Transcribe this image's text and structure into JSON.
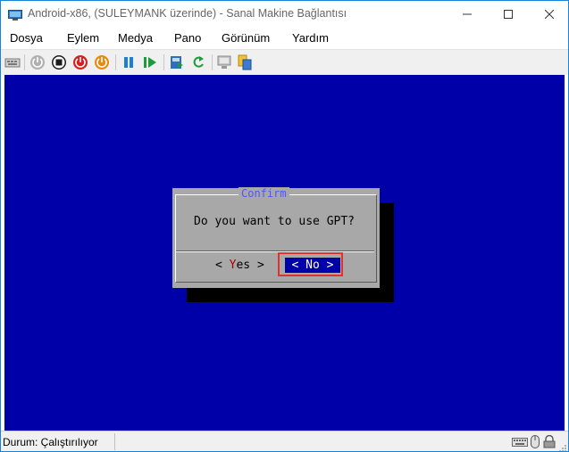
{
  "window": {
    "title": "Android-x86, (SULEYMANK üzerinde) - Sanal Makine Bağlantısı",
    "accent_color": "#1883d7"
  },
  "menu": {
    "items": [
      "Dosya",
      "Eylem",
      "Medya",
      "Pano",
      "Görünüm",
      "Yardım"
    ]
  },
  "toolbar": {
    "buttons": [
      "ctrl-alt-del-icon",
      "start-icon",
      "turn-off-icon",
      "shutdown-icon",
      "save-icon",
      "pause-icon",
      "resume-icon",
      "checkpoint-icon",
      "revert-icon",
      "enhanced-session-icon",
      "zoom-icon"
    ]
  },
  "vm_screen": {
    "background": "#0000a8",
    "dialog": {
      "title": "Confirm",
      "message": "Do you want to use GPT?",
      "yes_prefix": "< ",
      "yes_hotkey": "Y",
      "yes_rest": "es >",
      "no_label": "< No >",
      "selected": "No"
    }
  },
  "status": {
    "text": "Durum: Çalıştırılıyor"
  }
}
